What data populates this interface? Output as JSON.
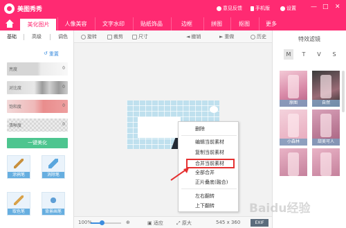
{
  "app": {
    "name": "美图秀秀"
  },
  "title_right": {
    "feedback": "意见反馈",
    "mobile": "手机版",
    "settings": "设置"
  },
  "tabs": [
    {
      "label": "美化图片"
    },
    {
      "label": "人像美容"
    },
    {
      "label": "文字水印"
    },
    {
      "label": "贴纸饰品"
    },
    {
      "label": "边框"
    },
    {
      "label": "拼图"
    },
    {
      "label": "抠图"
    },
    {
      "label": "更多"
    }
  ],
  "toolbar": {
    "rotate": "旋转",
    "crop": "裁剪",
    "size": "尺寸",
    "undo": "撤销",
    "redo": "重做",
    "history": "历史"
  },
  "left": {
    "tabs": [
      "基础",
      "高级",
      "调色"
    ],
    "reset": "重置",
    "sliders": [
      {
        "label": "亮度",
        "value": "0"
      },
      {
        "label": "对比度",
        "value": "0"
      },
      {
        "label": "饱和度",
        "value": "0"
      },
      {
        "label": "清晰度",
        "value": "0"
      }
    ],
    "beauty_button": "一键美化",
    "tools": [
      "涂鸦笔",
      "消除笔",
      "取色笔",
      "背景画笔"
    ]
  },
  "menu": {
    "items": [
      "删除",
      "编辑当前素材",
      "复制当前素材",
      "合并当前素材",
      "全部合并",
      "正片叠底(融合)",
      "左右翻转",
      "上下翻转"
    ],
    "highlighted": "合并当前素材"
  },
  "bottom": {
    "zoom": "100%",
    "fit": "适应",
    "original": "原大",
    "dimensions": "545 x 360",
    "exif": "EXIF"
  },
  "right": {
    "title": "特效滤镜",
    "letters": [
      "M",
      "T",
      "V",
      "S"
    ],
    "active_letter": "M",
    "filters": [
      "原图",
      "自然",
      "小森林",
      "甜美可人",
      "",
      ""
    ]
  },
  "watermark": "Baidu经验",
  "colors": {
    "brand": "#ff2a72",
    "accent_green": "#4dc58f",
    "highlight_red": "#e53030"
  }
}
